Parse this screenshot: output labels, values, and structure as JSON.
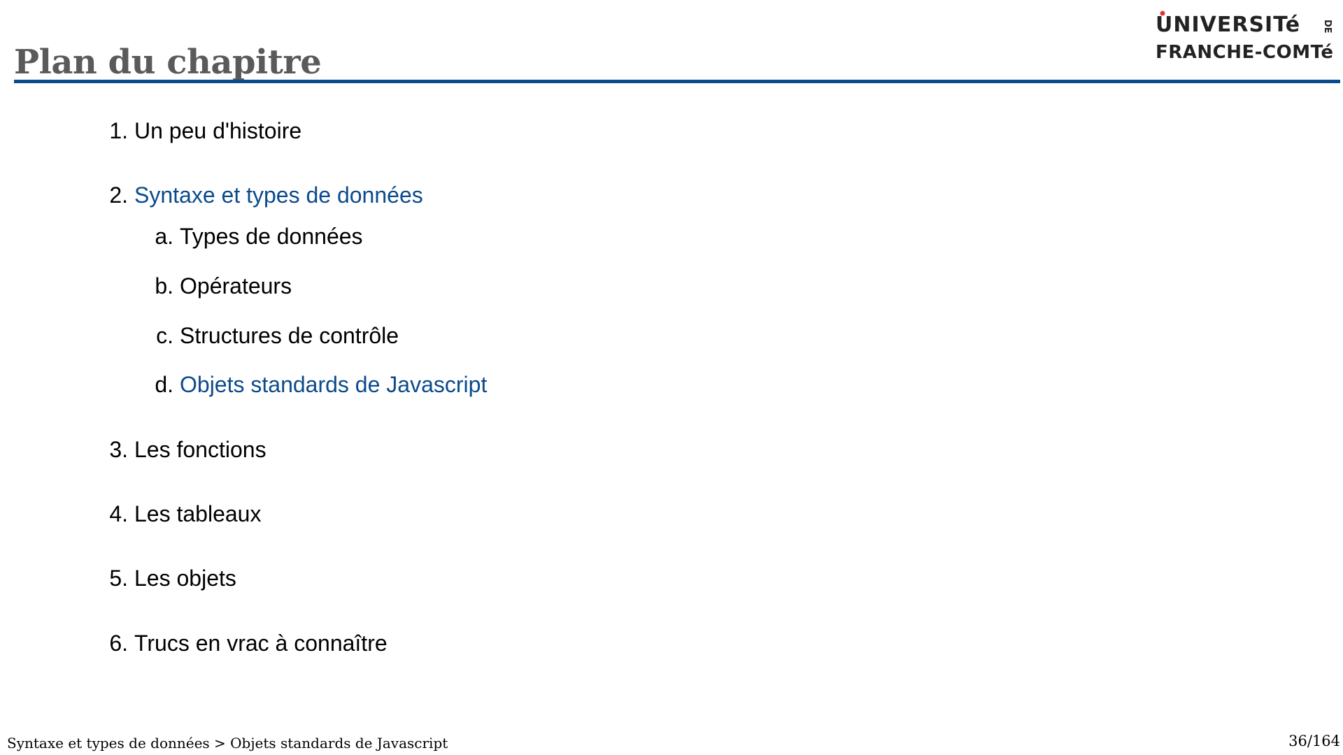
{
  "slide": {
    "title": "Plan du chapitre",
    "accent_color": "#0b4a8c",
    "title_color": "#5a5a5a"
  },
  "logo": {
    "line1": "UNIVERSITé",
    "line1_suffix": "DE",
    "line2": "FRANCHE-COMTé",
    "dot_color": "#e2323b"
  },
  "toc": {
    "items": [
      {
        "number": "1.",
        "label": "Un peu d'histoire",
        "active": false
      },
      {
        "number": "2.",
        "label": "Syntaxe et types de données",
        "active": true,
        "children": [
          {
            "number": "a.",
            "label": "Types de données",
            "active": false
          },
          {
            "number": "b.",
            "label": "Opérateurs",
            "active": false
          },
          {
            "number": "c.",
            "label": "Structures de contrôle",
            "active": false
          },
          {
            "number": "d.",
            "label": "Objets standards de Javascript",
            "active": true
          }
        ]
      },
      {
        "number": "3.",
        "label": "Les fonctions",
        "active": false
      },
      {
        "number": "4.",
        "label": "Les tableaux",
        "active": false
      },
      {
        "number": "5.",
        "label": "Les objets",
        "active": false
      },
      {
        "number": "6.",
        "label": "Trucs en vrac à connaître",
        "active": false
      }
    ]
  },
  "footer": {
    "breadcrumb": "Syntaxe et types de données > Objets standards de Javascript",
    "page": "36/164"
  }
}
